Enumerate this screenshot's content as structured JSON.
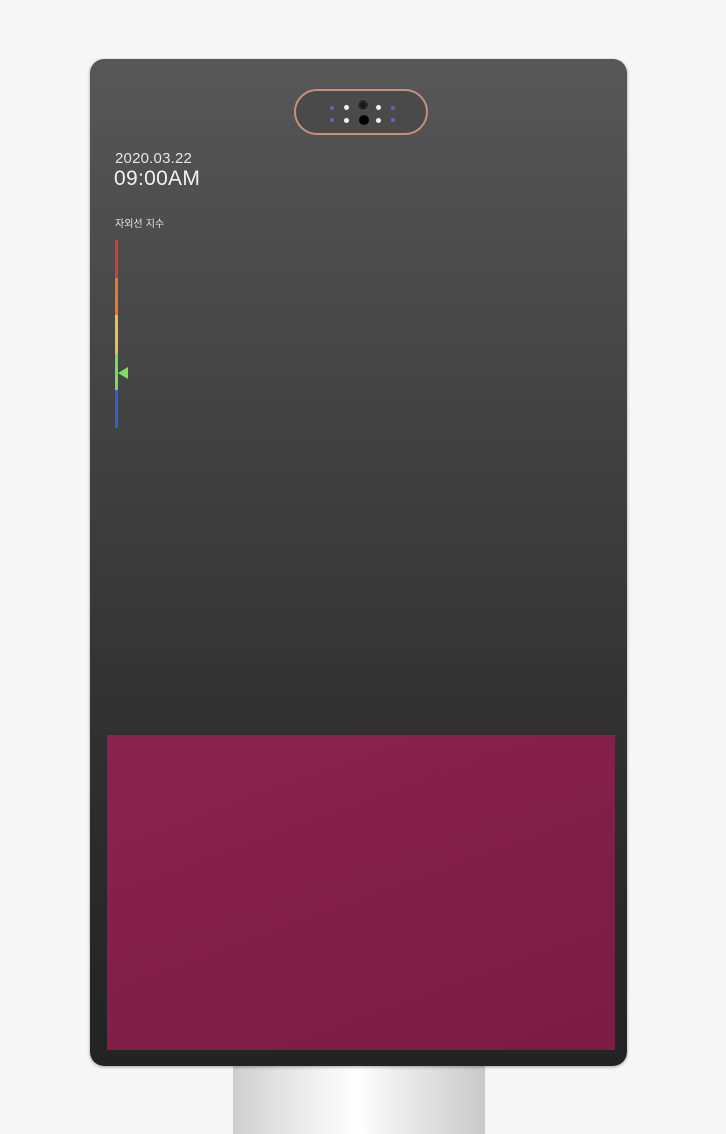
{
  "device": {
    "date": "2020.03.22",
    "time": "09:00AM",
    "sensor_label": "",
    "sensor_icon": "camera-icon"
  },
  "uv_index": {
    "label": "자외선 지수",
    "levels": [
      {
        "name": "very-high",
        "color": "#d9373c"
      },
      {
        "name": "high",
        "color": "#e9772e"
      },
      {
        "name": "moderate",
        "color": "#e8c43a"
      },
      {
        "name": "low",
        "color": "#7ed957"
      },
      {
        "name": "minimal",
        "color": "#3a5ccc"
      }
    ],
    "current_level": "low",
    "current_level_fraction": 0.71
  },
  "colors": {
    "screen": "#3d3d3d",
    "content_panel": "#86214a",
    "sensor_rim": "#c0917b"
  }
}
